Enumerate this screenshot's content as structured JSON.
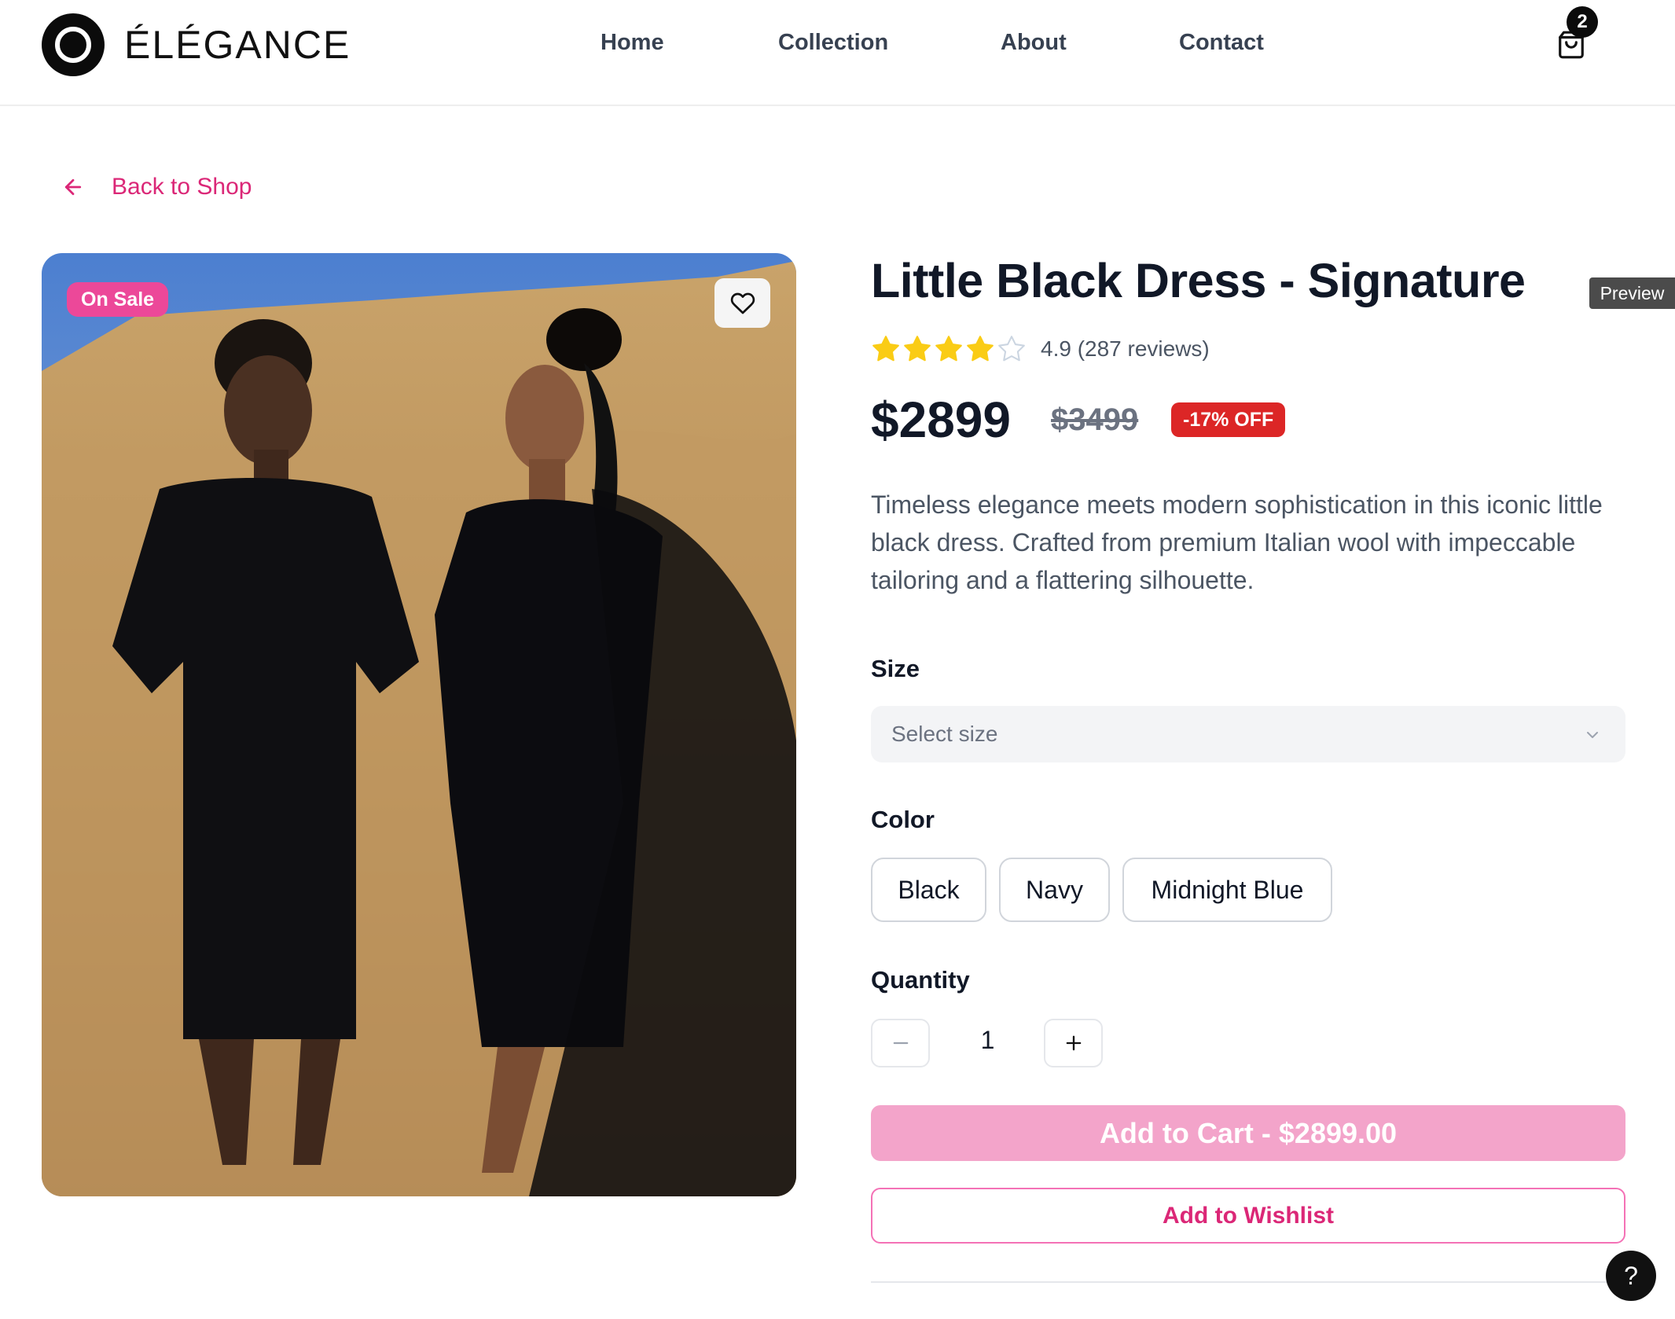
{
  "header": {
    "brand": "ÉLÉGANCE",
    "nav": [
      "Home",
      "Collection",
      "About",
      "Contact"
    ],
    "cart_count": "2"
  },
  "back_link": "Back to Shop",
  "product": {
    "badge": "On Sale",
    "title": "Little Black Dress - Signature",
    "rating_value": 4,
    "rating_max": 5,
    "rating_text": "4.9 (287 reviews)",
    "price": "$2899",
    "old_price": "$3499",
    "discount": "-17% OFF",
    "description": "Timeless elegance meets modern sophistication in this iconic little black dress. Crafted from premium Italian wool with impeccable tailoring and a flattering silhouette."
  },
  "size": {
    "label": "Size",
    "placeholder": "Select size"
  },
  "color": {
    "label": "Color",
    "options": [
      "Black",
      "Navy",
      "Midnight Blue"
    ]
  },
  "quantity": {
    "label": "Quantity",
    "value": "1"
  },
  "actions": {
    "add_to_cart": "Add to Cart - $2899.00",
    "add_to_wishlist": "Add to Wishlist"
  },
  "preview_tag": "Preview",
  "help": "?",
  "colors": {
    "accent": "#db2777",
    "sale_badge": "#ec4899",
    "discount_badge": "#dc2626",
    "add_to_cart_bg": "#f3a4ca",
    "star": "#facc15"
  }
}
